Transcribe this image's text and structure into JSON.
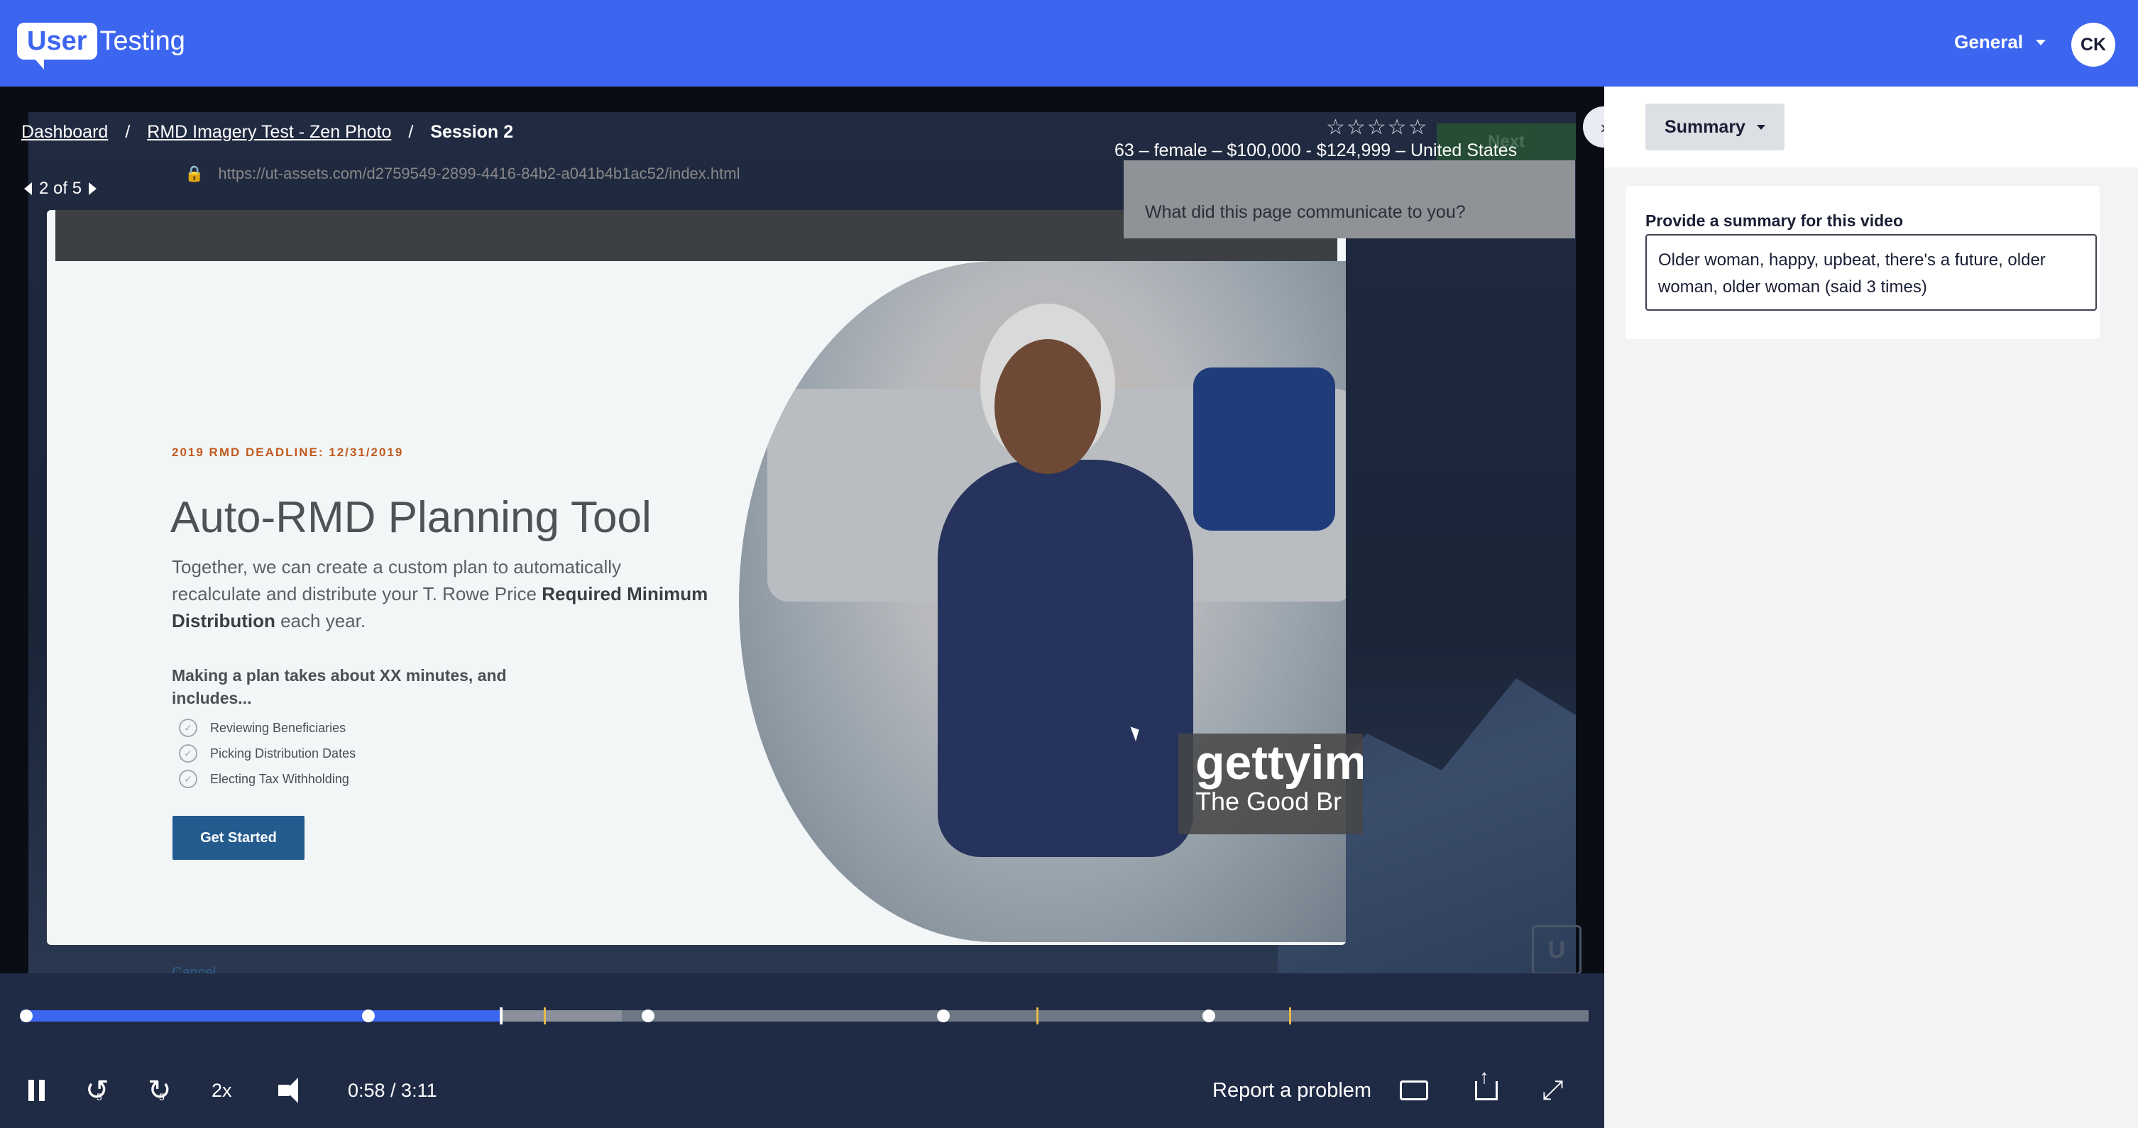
{
  "brand": {
    "logo_user": "User",
    "logo_testing": "Testing",
    "accent": "#3c66f0"
  },
  "header": {
    "workspace_label": "General",
    "avatar_initials": "CK"
  },
  "breadcrumb": {
    "dashboard": "Dashboard",
    "test": "RMD Imagery Test - Zen Photo",
    "session": "Session 2",
    "sep": "/"
  },
  "session_nav": {
    "position": "2 of 5"
  },
  "rating": {
    "stars": "☆☆☆☆☆"
  },
  "participant": {
    "demographics": "63 – female – $100,000 - $124,999 – United States"
  },
  "video_content": {
    "browser_url": "https://ut-assets.com/d2759549-2899-4416-84b2-a041b4b1ac52/index.html",
    "question": "What did this page communicate to you?",
    "next_label": "Next",
    "deadline": "2019 RMD DEADLINE: 12/31/2019",
    "title": "Auto-RMD Planning Tool",
    "desc_part1": "Together, we can create a custom plan to automatically recalculate and distribute your T. Rowe Price ",
    "desc_bold": "Required Minimum Distribution",
    "desc_part2": " each year.",
    "plan_text": "Making a plan takes about XX minutes, and includes...",
    "checklist": [
      "Reviewing Beneficiaries",
      "Picking Distribution Dates",
      "Electing Tax Withholding"
    ],
    "get_started": "Get Started",
    "cancel": "Cancel",
    "watermark_main": "gettyim",
    "watermark_sub": "The Good Br",
    "badge": "U"
  },
  "timeline": {
    "progress": 0.306
  },
  "controls": {
    "speed": "2x",
    "time": "0:58 / 3:11",
    "skip_back": "5",
    "skip_fwd": "5",
    "report": "Report a problem"
  },
  "sidebar": {
    "summary_button": "Summary",
    "summary_label": "Provide a summary for this video",
    "summary_value": "Older woman, happy, upbeat, there's a future, older woman, older woman (said 3 times)"
  },
  "icons": {
    "pause": "pause-icon",
    "rewind": "rewind-5-icon",
    "forward": "forward-5-icon",
    "volume": "volume-icon",
    "keyboard": "keyboard-icon",
    "share": "share-icon",
    "fullscreen": "fullscreen-icon",
    "chevron": "chevron-right-icon"
  }
}
